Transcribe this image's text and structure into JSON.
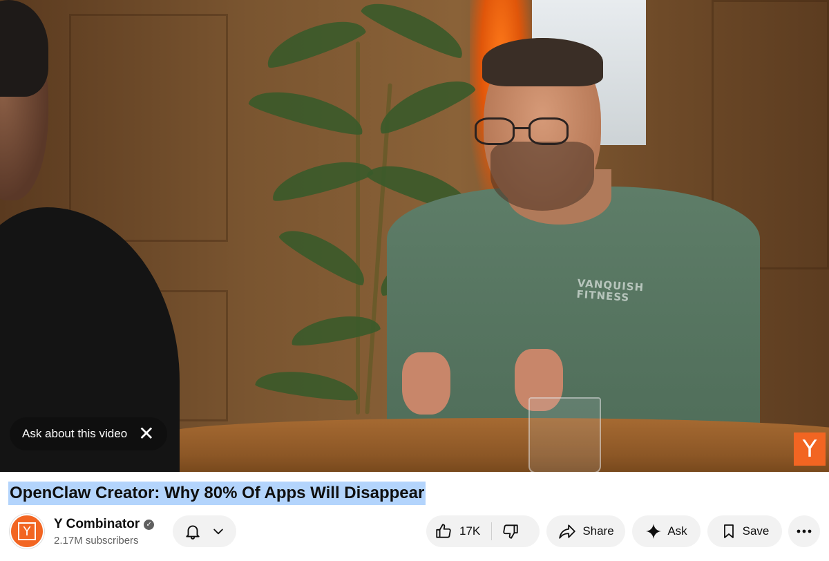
{
  "video": {
    "ask_overlay_label": "Ask about this video",
    "ask_overlay_close": "✕",
    "watermark_letter": "Y",
    "shirt_text_line1": "VANQUISH",
    "shirt_text_line2": "FITNESS"
  },
  "title": "OpenClaw Creator: Why 80% Of Apps Will Disappear",
  "channel": {
    "avatar_letter": "Y",
    "name": "Y Combinator",
    "verified_mark": "✓",
    "subscribers": "2.17M subscribers"
  },
  "actions": {
    "likes": "17K",
    "share_label": "Share",
    "ask_label": "Ask",
    "save_label": "Save"
  },
  "colors": {
    "brand_orange": "#f26522",
    "pill_bg": "#f2f2f2",
    "title_highlight": "#b3d4fc"
  }
}
